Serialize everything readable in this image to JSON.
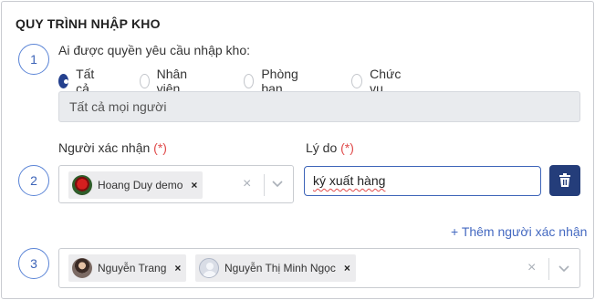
{
  "title": "QUY TRÌNH NHẬP KHO",
  "steps": [
    "1",
    "2",
    "3"
  ],
  "section1": {
    "question": "Ai được quyền yêu cầu nhập kho:",
    "options": [
      {
        "label": "Tất cả",
        "checked": true
      },
      {
        "label": "Nhân viên",
        "checked": false
      },
      {
        "label": "Phòng ban",
        "checked": false
      },
      {
        "label": "Chức vụ",
        "checked": false
      }
    ],
    "scope_value": "Tất cả mọi người"
  },
  "section2": {
    "confirm_label": "Người xác nhận",
    "reason_label": "Lý do",
    "required_mark": "(*)",
    "confirmers": [
      {
        "name": "Hoang Duy demo",
        "avatar": "rose-photo",
        "remove": "×"
      }
    ],
    "reason_value": "ký xuất hàng",
    "clear_icon": "×",
    "delete_icon": "trash-icon"
  },
  "add_confirmer_link": "+ Thêm người xác nhận",
  "section3": {
    "confirmers": [
      {
        "name": "Nguyễn Trang",
        "avatar": "woman-photo",
        "remove": "×"
      },
      {
        "name": "Nguyễn Thị Minh Ngọc",
        "avatar": "default-avatar",
        "remove": "×"
      }
    ],
    "clear_icon": "×"
  },
  "colors": {
    "accent": "#24408e",
    "step_border": "#5a84d6",
    "link": "#4469c1",
    "required": "#e04b4b"
  }
}
